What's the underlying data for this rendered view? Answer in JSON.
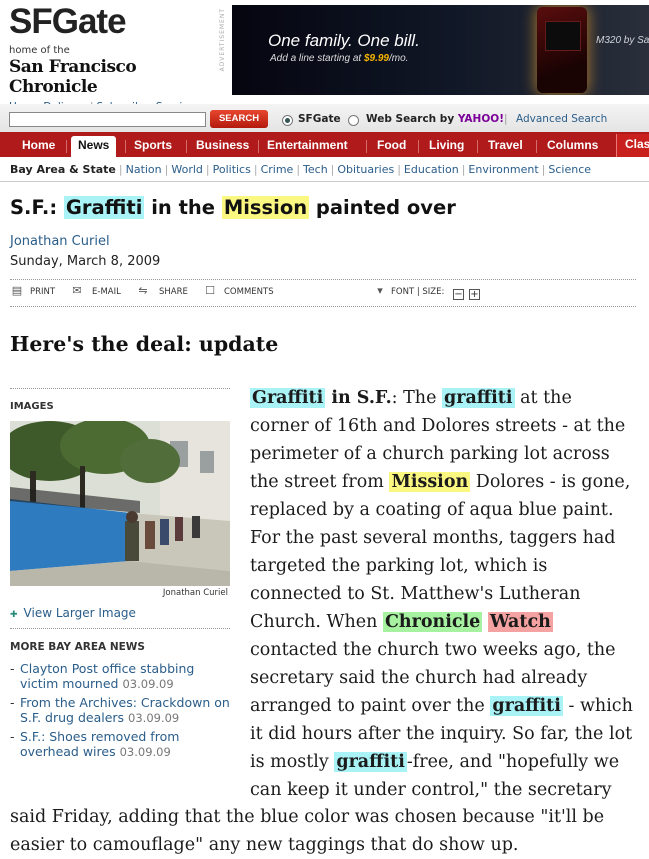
{
  "header": {
    "logo": "SFGate",
    "home_of": "home of the",
    "chronicle": "San Francisco Chronicle",
    "links": [
      "Home Delivery",
      "Subscriber Services"
    ],
    "link_sep": "|"
  },
  "ad": {
    "label": "ADVERTISEMENT",
    "headline": "One family. One bill.",
    "sub_prefix": "Add a line starting at ",
    "sub_price": "$9.99",
    "sub_suffix": "/mo.",
    "model": "M320 by Sa"
  },
  "search": {
    "button_label": "SEARCH",
    "input_value": "",
    "options": [
      {
        "label": "SFGate",
        "selected": true
      },
      {
        "label": "Web Search by ",
        "brand": "YAHOO!",
        "selected": false
      }
    ],
    "sep": "|",
    "advanced": "Advanced Search"
  },
  "nav": {
    "tabs": [
      {
        "label": "Home",
        "active": false
      },
      {
        "label": "News",
        "active": true
      },
      {
        "label": "Sports",
        "active": false
      },
      {
        "label": "Business",
        "active": false
      },
      {
        "label": "Entertainment",
        "active": false
      },
      {
        "label": "Food",
        "active": false
      },
      {
        "label": "Living",
        "active": false
      },
      {
        "label": "Travel",
        "active": false
      },
      {
        "label": "Columns",
        "active": false
      },
      {
        "label": "Clas",
        "active": false
      }
    ],
    "accent": "#b01a1b"
  },
  "subnav": {
    "current": "Bay Area & State",
    "items": [
      "Nation",
      "World",
      "Politics",
      "Crime",
      "Tech",
      "Obituaries",
      "Education",
      "Environment",
      "Science"
    ],
    "sep": "|"
  },
  "article": {
    "headline": {
      "prefix": "S.F.: ",
      "w1": "Graffiti",
      "mid1": " in the ",
      "w2": "Mission",
      "suffix": " painted over"
    },
    "author": "Jonathan Curiel",
    "date": "Sunday, March 8, 2009",
    "tools": {
      "print": "PRINT",
      "email": "E-MAIL",
      "share": "SHARE",
      "comments": "COMMENTS",
      "font_size": "FONT | SIZE:",
      "minus": "−",
      "plus": "+"
    },
    "section_title": "Here's the deal: update",
    "images_label": "IMAGES",
    "photo_credit": "Jonathan Curiel",
    "view_larger": "View Larger Image",
    "more_label": "MORE BAY AREA NEWS",
    "more_items": [
      {
        "title": "Clayton Post office stabbing victim mourned",
        "date": "03.09.09"
      },
      {
        "title": "From the Archives: Crackdown on S.F. drug dealers",
        "date": "03.09.09"
      },
      {
        "title": "S.F.: Shoes removed from overhead wires",
        "date": "03.09.09"
      }
    ],
    "body": {
      "l1_a": "Graffiti",
      "l1_b": " in S.F.",
      "l1_c": ": The ",
      "l1_d": "graffiti",
      "l1_e": " at the",
      "l2": "corner of 16th and Dolores streets - at the",
      "l3": "perimeter of a church parking lot across",
      "l4_a": "the street from ",
      "l4_b": "Mission",
      "l4_c": " Dolores - is gone,",
      "l5": "replaced by a coating of aqua blue paint.",
      "l6": "For the past several months, taggers had",
      "l7": "targeted the parking lot, which is",
      "l8": "connected to St. Matthew's Lutheran",
      "l9_a": "Church. When ",
      "l9_b": "Chronicle",
      "l9_c": " ",
      "l9_d": "Watch",
      "l10": "contacted the church two weeks ago, the",
      "l11": "secretary said the church had already",
      "l12_a": "arranged to paint over the ",
      "l12_b": "graffiti",
      "l12_c": " - which",
      "l13": "it did hours after the inquiry. So far, the lot",
      "l14_a": "is mostly ",
      "l14_b": "graffiti",
      "l14_c": "-free, and \"hopefully we",
      "l15": "can keep it under control,\" the secretary",
      "l16": "said Friday, adding that the blue color was chosen because \"it'll be",
      "l17": "easier to camouflage\" any new taggings that do show up."
    },
    "highlight_colors": {
      "cyan": "#a9f3f7",
      "yellow": "#fbf882",
      "green": "#a6f2a0",
      "red": "#f5a2a2"
    }
  }
}
